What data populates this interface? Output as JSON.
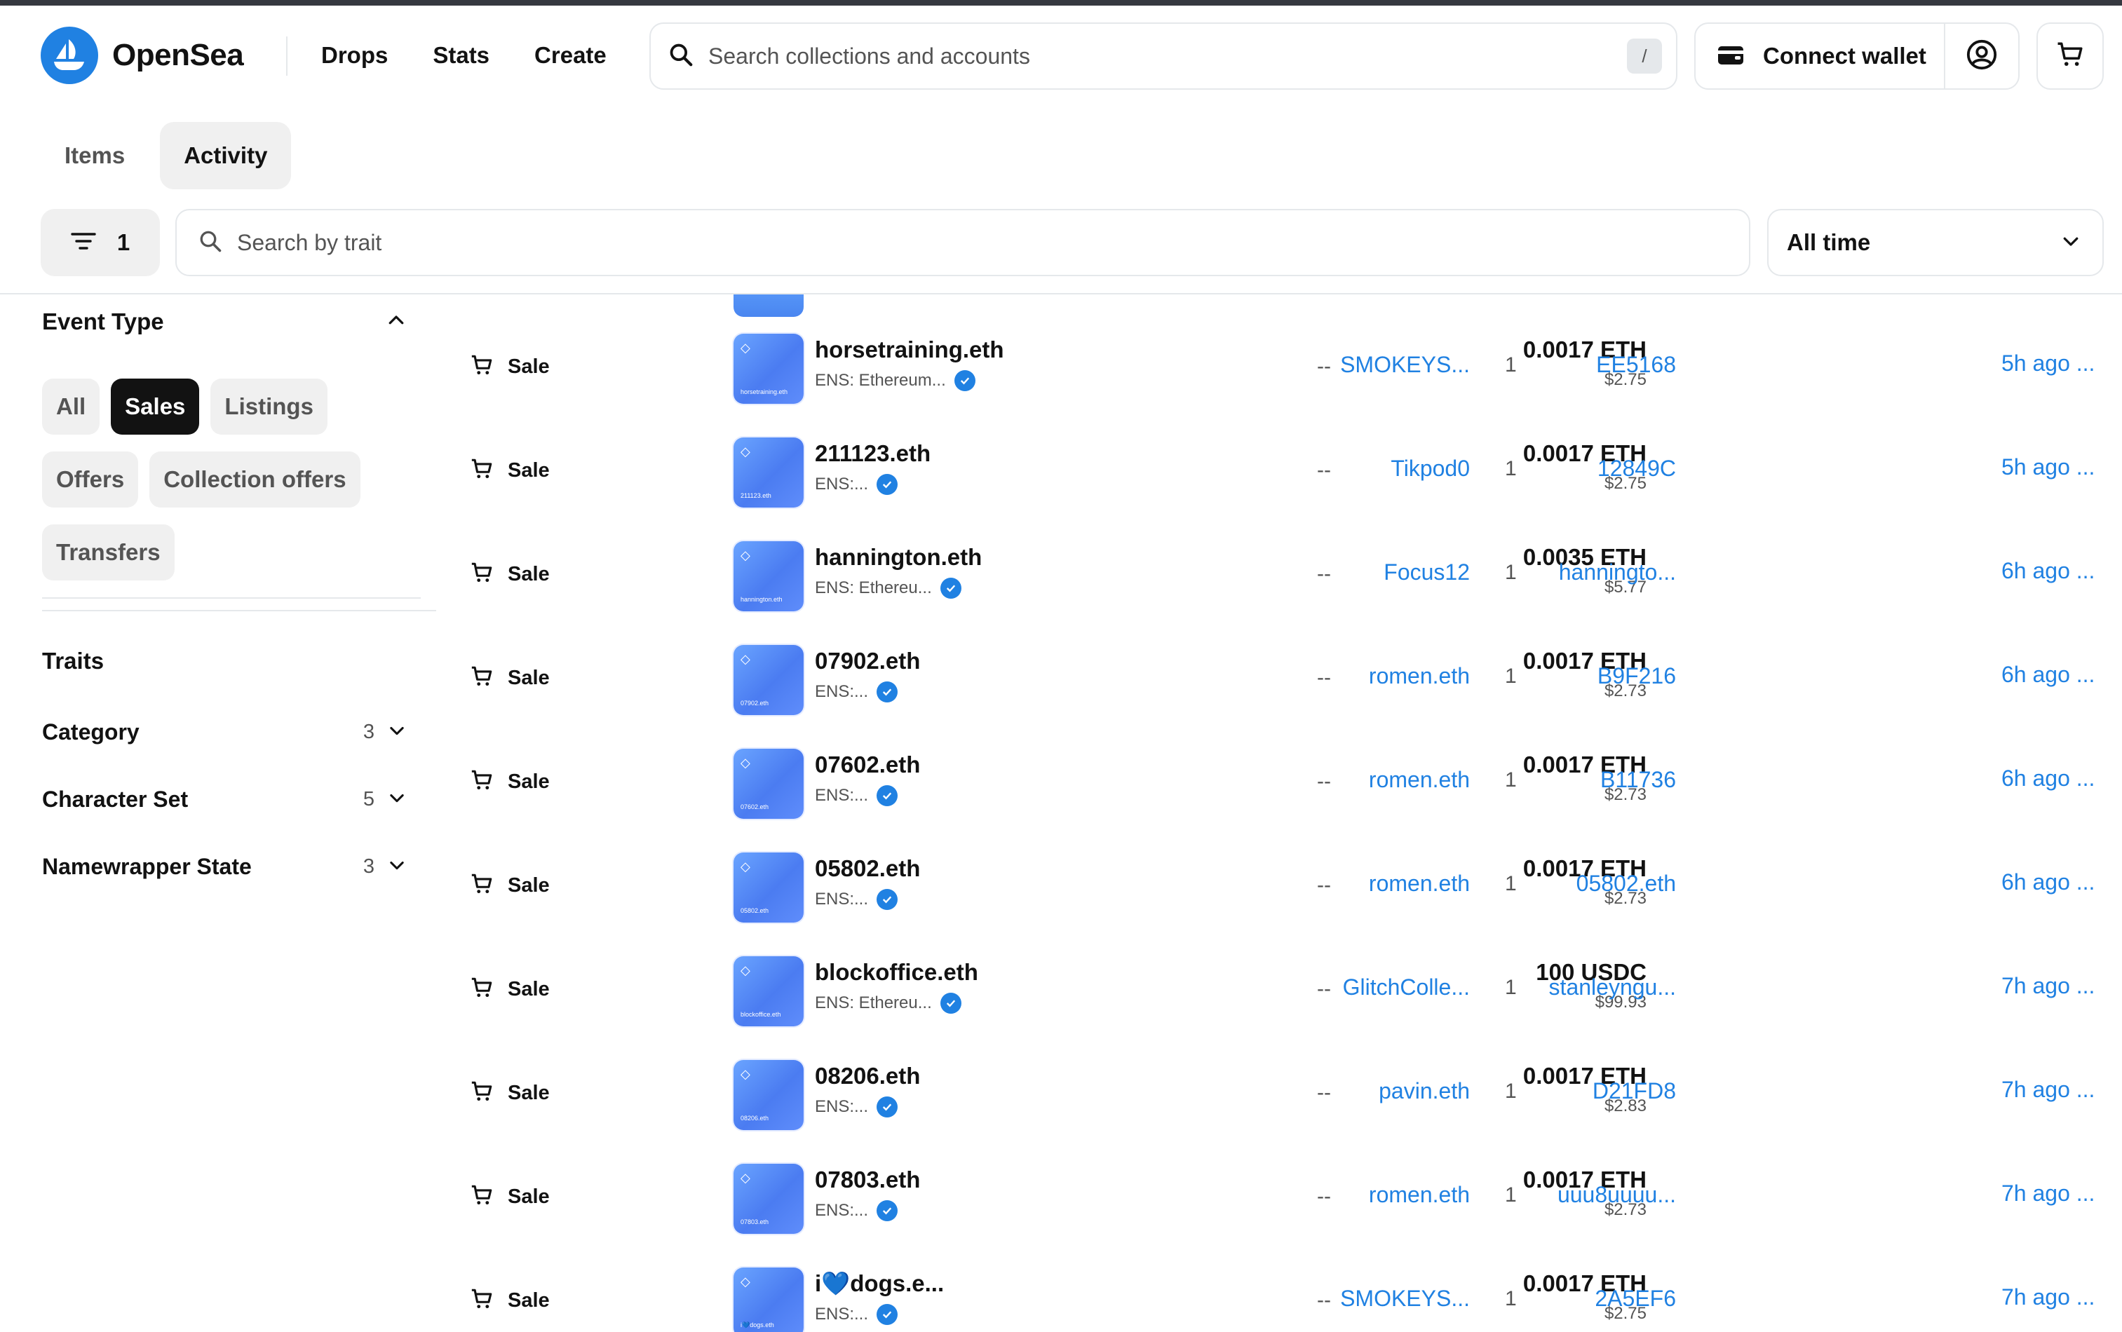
{
  "header": {
    "logo_text": "OpenSea",
    "nav": [
      "Drops",
      "Stats",
      "Create"
    ],
    "search_placeholder": "Search collections and accounts",
    "search_shortcut": "/",
    "connect_label": "Connect wallet"
  },
  "tabs": [
    {
      "label": "Items",
      "active": false
    },
    {
      "label": "Activity",
      "active": true
    }
  ],
  "filters": {
    "count": "1",
    "trait_search_placeholder": "Search by trait",
    "time_range": "All time"
  },
  "sidebar": {
    "event_type_title": "Event Type",
    "event_types": [
      {
        "label": "All",
        "active": false
      },
      {
        "label": "Sales",
        "active": true
      },
      {
        "label": "Listings",
        "active": false
      },
      {
        "label": "Offers",
        "active": false
      },
      {
        "label": "Collection offers",
        "active": false
      },
      {
        "label": "Transfers",
        "active": false
      }
    ],
    "traits_title": "Traits",
    "traits": [
      {
        "name": "Category",
        "count": "3"
      },
      {
        "name": "Character Set",
        "count": "5"
      },
      {
        "name": "Namewrapper State",
        "count": "3"
      }
    ]
  },
  "rows": [
    {
      "event": "Sale",
      "name": "horsetraining.eth",
      "thumb": "horsetraining.eth",
      "sub": "ENS: Ethereum...",
      "price": "0.0017 ETH",
      "usd": "$2.75",
      "floor": "--",
      "qty": "1",
      "from": "SMOKEYS...",
      "to": "EE5168",
      "time": "5h ago ..."
    },
    {
      "event": "Sale",
      "name": "211123.eth",
      "thumb": "211123.eth",
      "sub": "ENS:...",
      "price": "0.0017 ETH",
      "usd": "$2.75",
      "floor": "--",
      "qty": "1",
      "from": "Tikpod0",
      "to": "12849C",
      "time": "5h ago ..."
    },
    {
      "event": "Sale",
      "name": "hannington.eth",
      "thumb": "hannington.eth",
      "sub": "ENS: Ethereu...",
      "price": "0.0035 ETH",
      "usd": "$5.77",
      "floor": "--",
      "qty": "1",
      "from": "Focus12",
      "to": "hanningto...",
      "time": "6h ago ..."
    },
    {
      "event": "Sale",
      "name": "07902.eth",
      "thumb": "07902.eth",
      "sub": "ENS:...",
      "price": "0.0017 ETH",
      "usd": "$2.73",
      "floor": "--",
      "qty": "1",
      "from": "romen.eth",
      "to": "B9F216",
      "time": "6h ago ..."
    },
    {
      "event": "Sale",
      "name": "07602.eth",
      "thumb": "07602.eth",
      "sub": "ENS:...",
      "price": "0.0017 ETH",
      "usd": "$2.73",
      "floor": "--",
      "qty": "1",
      "from": "romen.eth",
      "to": "B11736",
      "time": "6h ago ..."
    },
    {
      "event": "Sale",
      "name": "05802.eth",
      "thumb": "05802.eth",
      "sub": "ENS:...",
      "price": "0.0017 ETH",
      "usd": "$2.73",
      "floor": "--",
      "qty": "1",
      "from": "romen.eth",
      "to": "05802.eth",
      "time": "6h ago ..."
    },
    {
      "event": "Sale",
      "name": "blockoffice.eth",
      "thumb": "blockoffice.eth",
      "sub": "ENS: Ethereu...",
      "price": "100 USDC",
      "usd": "$99.93",
      "floor": "--",
      "qty": "1",
      "from": "GlitchColle...",
      "to": "stanleyngu...",
      "time": "7h ago ..."
    },
    {
      "event": "Sale",
      "name": "08206.eth",
      "thumb": "08206.eth",
      "sub": "ENS:...",
      "price": "0.0017 ETH",
      "usd": "$2.83",
      "floor": "--",
      "qty": "1",
      "from": "pavin.eth",
      "to": "D21FD8",
      "time": "7h ago ..."
    },
    {
      "event": "Sale",
      "name": "07803.eth",
      "thumb": "07803.eth",
      "sub": "ENS:...",
      "price": "0.0017 ETH",
      "usd": "$2.73",
      "floor": "--",
      "qty": "1",
      "from": "romen.eth",
      "to": "uuu8uuuu...",
      "time": "7h ago ..."
    },
    {
      "event": "Sale",
      "name": "i💙dogs.e...",
      "thumb": "i💙dogs.eth",
      "sub": "ENS:...",
      "price": "0.0017 ETH",
      "usd": "$2.75",
      "floor": "--",
      "qty": "1",
      "from": "SMOKEYS...",
      "to": "2A5EF6",
      "time": "7h ago ..."
    }
  ],
  "colors": {
    "accent": "#2081e2",
    "text": "#121212",
    "muted": "#545454",
    "border": "#e5e8eb",
    "chip": "#f0f0f0"
  }
}
